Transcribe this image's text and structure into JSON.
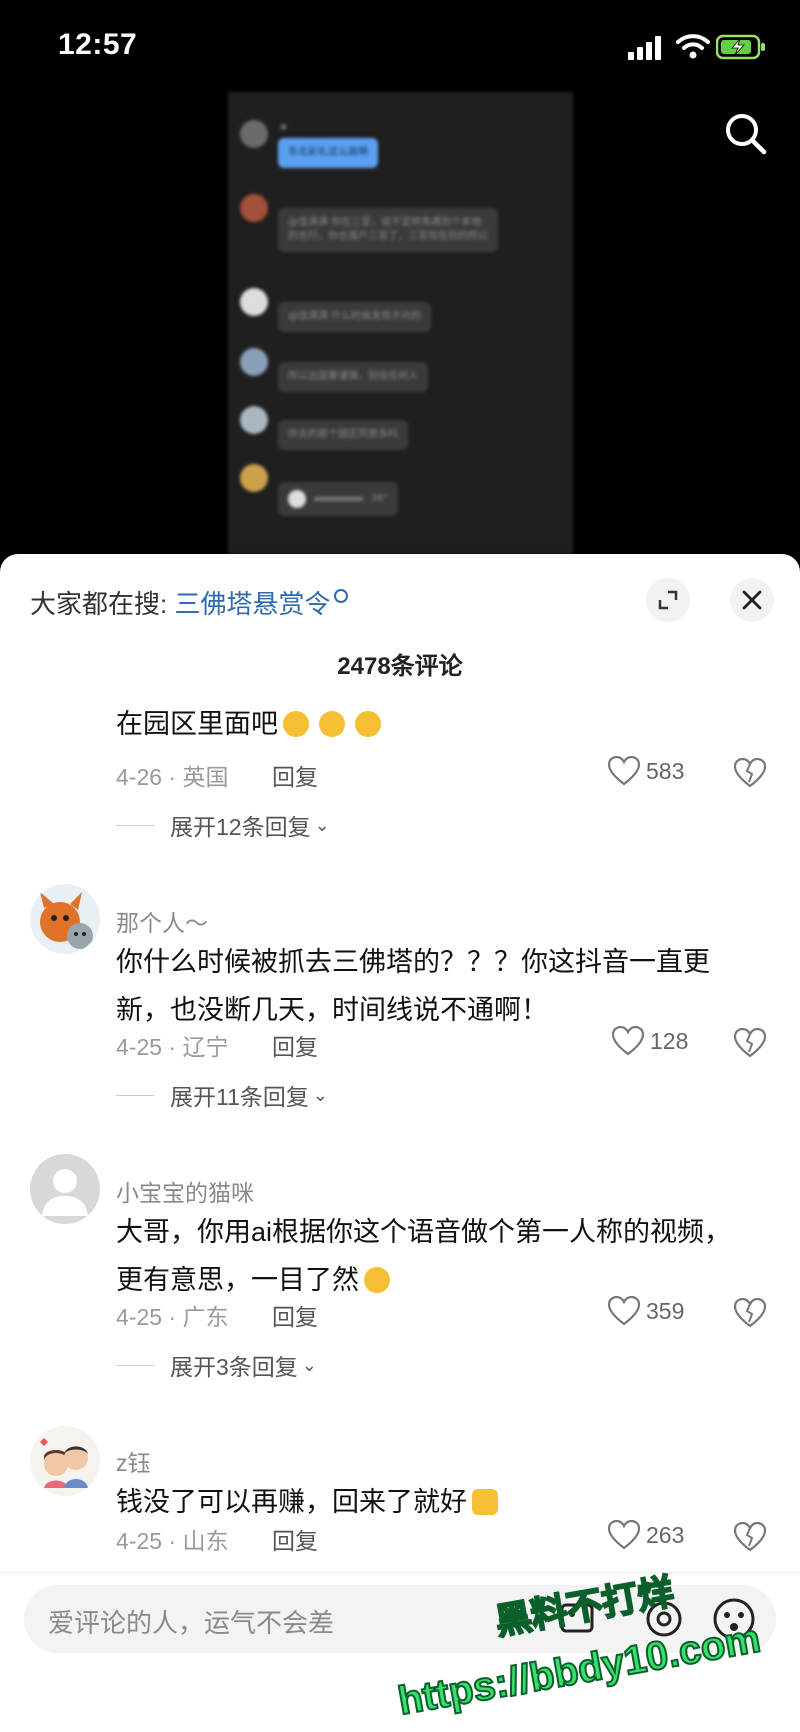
{
  "status_bar": {
    "time": "12:57"
  },
  "video_chat": {
    "messages": [
      {
        "text": "东北彩礼这么高啊",
        "style": "blue"
      },
      {
        "text": "@佳满满 你在三亚，说不定转角遇到个本地的也行，你也落户三亚了，三亚现在别的所以"
      },
      {
        "text": "@佳满满 什么时候发现不对的"
      },
      {
        "text": "所以出国要谨慎，别信任何人"
      },
      {
        "text": "你去的那个园区同意多吗"
      },
      {
        "text": "36\""
      }
    ]
  },
  "sheet": {
    "hot_search_prefix": "大家都在搜:",
    "hot_search_keyword": "三佛塔悬赏令",
    "comment_count": "2478条评论"
  },
  "comments": [
    {
      "text": "在园区里面吧",
      "date": "4-26 · 英国",
      "reply": "回复",
      "likes": "583",
      "expand": "展开12条回复"
    },
    {
      "username": "那个人～",
      "text_line1": "你什么时候被抓去三佛塔的？？？你这抖音一直更",
      "text_line2": "新，也没断几天，时间线说不通啊！",
      "date": "4-25 · 辽宁",
      "reply": "回复",
      "likes": "128",
      "expand": "展开11条回复"
    },
    {
      "username": "小宝宝的猫咪",
      "text_line1": "大哥，你用ai根据你这个语音做个第一人称的视频，",
      "text_line2": "更有意思，一目了然",
      "date": "4-25 · 广东",
      "reply": "回复",
      "likes": "359",
      "expand": "展开3条回复"
    },
    {
      "username": "z钰",
      "text": "钱没了可以再赚，回来了就好",
      "date": "4-25 · 山东",
      "reply": "回复",
      "likes": "263"
    }
  ],
  "input": {
    "placeholder": "爱评论的人，运气不会差"
  },
  "watermark": {
    "line1": "黑料不打烊",
    "line2": "https://bbdy10.com"
  },
  "colors": {
    "accent": "#2f6bad",
    "watermark": "#37e06a"
  }
}
